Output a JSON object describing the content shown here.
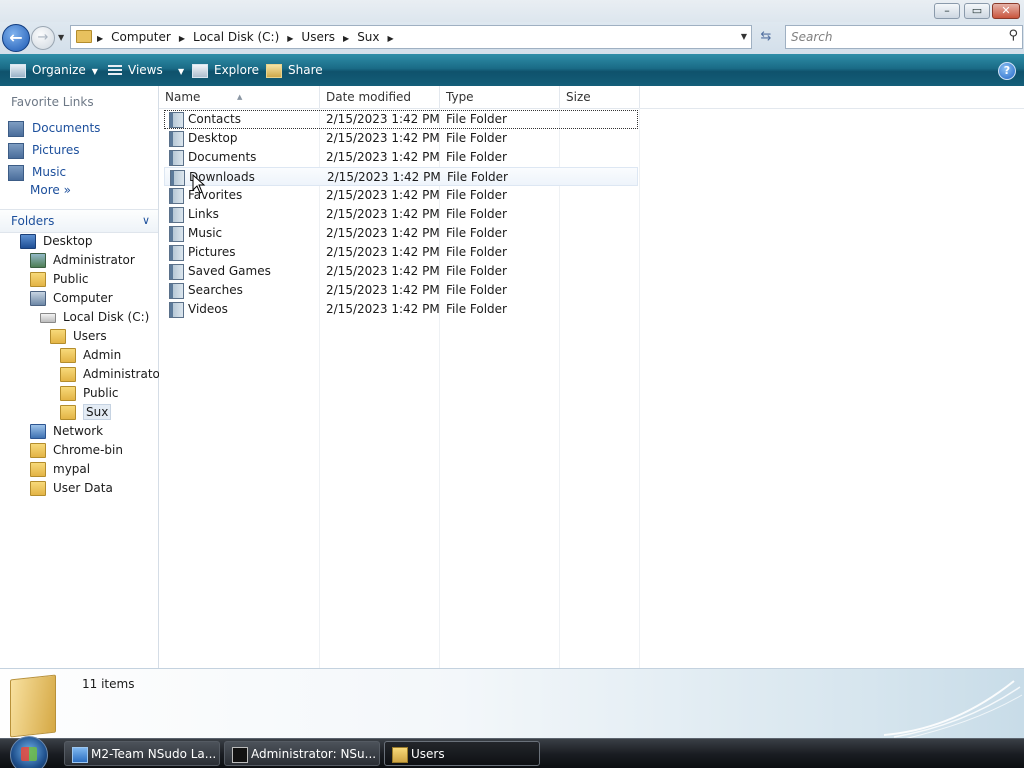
{
  "window": {
    "caption_buttons": {
      "minimize": "–",
      "maximize": "▭",
      "close": "✕"
    }
  },
  "address": {
    "breadcrumbs": [
      "Computer",
      "Local Disk (C:)",
      "Users",
      "Sux"
    ],
    "search_placeholder": "Search"
  },
  "toolbar": {
    "organize": "Organize",
    "views": "Views",
    "explore": "Explore",
    "share": "Share",
    "help": "?"
  },
  "nav": {
    "favorite_links_title": "Favorite Links",
    "favorites": [
      {
        "label": "Documents",
        "icon": "documents-icon"
      },
      {
        "label": "Pictures",
        "icon": "pictures-icon"
      },
      {
        "label": "Music",
        "icon": "music-icon"
      }
    ],
    "more": "More",
    "more_glyph": "»",
    "folders_title": "Folders",
    "tree": [
      {
        "label": "Desktop",
        "icon": "desktop-icon",
        "indent": 0
      },
      {
        "label": "Administrator",
        "icon": "user-folder-icon",
        "indent": 1
      },
      {
        "label": "Public",
        "icon": "folder-icon",
        "indent": 1
      },
      {
        "label": "Computer",
        "icon": "computer-icon",
        "indent": 1
      },
      {
        "label": "Local Disk (C:)",
        "icon": "disk-icon",
        "indent": 2
      },
      {
        "label": "Users",
        "icon": "folder-icon",
        "indent": 3
      },
      {
        "label": "Admin",
        "icon": "folder-icon",
        "indent": 4
      },
      {
        "label": "Administrator",
        "icon": "folder-icon",
        "indent": 4
      },
      {
        "label": "Public",
        "icon": "folder-icon",
        "indent": 4
      },
      {
        "label": "Sux",
        "icon": "folder-icon",
        "indent": 4,
        "selected": true
      },
      {
        "label": "Network",
        "icon": "network-icon",
        "indent": 1
      },
      {
        "label": "Chrome-bin",
        "icon": "folder-icon",
        "indent": 1
      },
      {
        "label": "mypal",
        "icon": "folder-icon",
        "indent": 1
      },
      {
        "label": "User Data",
        "icon": "folder-icon",
        "indent": 1
      }
    ]
  },
  "filelist": {
    "columns": {
      "name": "Name",
      "date": "Date modified",
      "type": "Type",
      "size": "Size"
    },
    "rows": [
      {
        "name": "Contacts",
        "date": "2/15/2023 1:42 PM",
        "type": "File Folder",
        "size": ""
      },
      {
        "name": "Desktop",
        "date": "2/15/2023 1:42 PM",
        "type": "File Folder",
        "size": ""
      },
      {
        "name": "Documents",
        "date": "2/15/2023 1:42 PM",
        "type": "File Folder",
        "size": ""
      },
      {
        "name": "Downloads",
        "date": "2/15/2023 1:42 PM",
        "type": "File Folder",
        "size": ""
      },
      {
        "name": "Favorites",
        "date": "2/15/2023 1:42 PM",
        "type": "File Folder",
        "size": ""
      },
      {
        "name": "Links",
        "date": "2/15/2023 1:42 PM",
        "type": "File Folder",
        "size": ""
      },
      {
        "name": "Music",
        "date": "2/15/2023 1:42 PM",
        "type": "File Folder",
        "size": ""
      },
      {
        "name": "Pictures",
        "date": "2/15/2023 1:42 PM",
        "type": "File Folder",
        "size": ""
      },
      {
        "name": "Saved Games",
        "date": "2/15/2023 1:42 PM",
        "type": "File Folder",
        "size": ""
      },
      {
        "name": "Searches",
        "date": "2/15/2023 1:42 PM",
        "type": "File Folder",
        "size": ""
      },
      {
        "name": "Videos",
        "date": "2/15/2023 1:42 PM",
        "type": "File Folder",
        "size": ""
      }
    ]
  },
  "details": {
    "item_count": "11 items"
  },
  "taskbar": {
    "tasks": [
      {
        "label": "M2-Team NSudo La...",
        "icon": "nsudo-icon"
      },
      {
        "label": "Administrator: NSu...",
        "icon": "console-icon"
      },
      {
        "label": "Users",
        "icon": "explorer-folder-icon",
        "active": true
      }
    ]
  },
  "colors": {
    "toolbar_accent": "#1a6b86",
    "link_blue": "#1c4f9c",
    "taskbar_dark": "#1a1d22"
  }
}
